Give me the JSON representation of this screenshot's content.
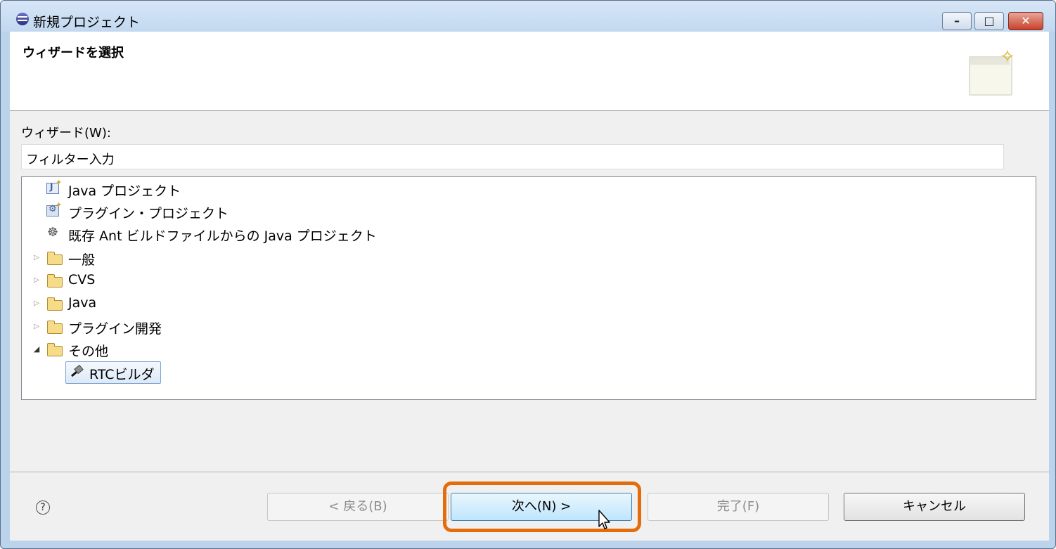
{
  "window": {
    "title": "新規プロジェクト",
    "minimize": "–",
    "maximize": "□",
    "close": "✕"
  },
  "header": {
    "title": "ウィザードを選択"
  },
  "wizard_label": "ウィザード(W):",
  "filter": {
    "value": "フィルター入力"
  },
  "tree": {
    "items": [
      {
        "label": "Java プロジェクト",
        "icon": "java-project-icon"
      },
      {
        "label": "プラグイン・プロジェクト",
        "icon": "plugin-project-icon"
      },
      {
        "label": "既存 Ant ビルドファイルからの Java プロジェクト",
        "icon": "ant-icon"
      },
      {
        "label": "一般",
        "icon": "folder-icon",
        "expandable": true
      },
      {
        "label": "CVS",
        "icon": "folder-icon",
        "expandable": true
      },
      {
        "label": "Java",
        "icon": "folder-icon",
        "expandable": true
      },
      {
        "label": "プラグイン開発",
        "icon": "folder-icon",
        "expandable": true
      },
      {
        "label": "その他",
        "icon": "folder-icon",
        "expanded": true
      },
      {
        "label": "RTCビルダ",
        "icon": "hammer-icon",
        "selected": true
      }
    ],
    "collapsed_glyph": "▷",
    "expanded_glyph": "◢"
  },
  "footer": {
    "help": "?",
    "back": "< 戻る(B)",
    "next": "次へ(N) >",
    "finish": "完了(F)",
    "cancel": "キャンセル"
  },
  "colors": {
    "highlight": "#e46c0a",
    "next_button": "#bee6fd"
  }
}
